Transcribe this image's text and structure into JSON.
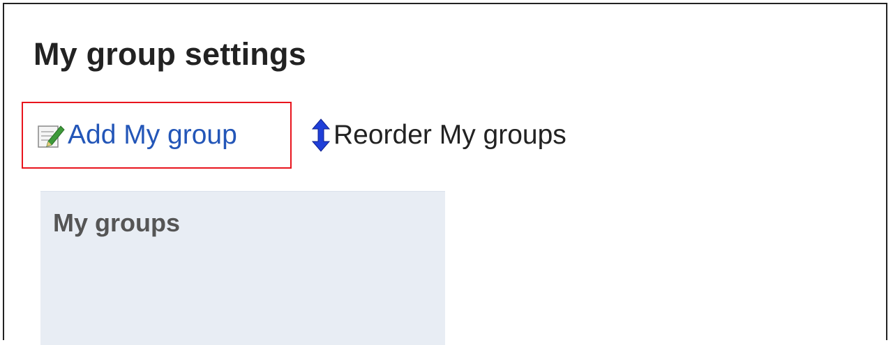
{
  "page": {
    "title": "My group settings"
  },
  "toolbar": {
    "add_label": "Add My group",
    "reorder_label": "Reorder My groups"
  },
  "panel": {
    "title": "My groups"
  },
  "colors": {
    "link_blue": "#2356b8",
    "highlight_red": "#e8141d",
    "panel_bg": "#e8edf4"
  },
  "icons": {
    "add": "edit-pencil-icon",
    "reorder": "vertical-arrows-icon"
  }
}
